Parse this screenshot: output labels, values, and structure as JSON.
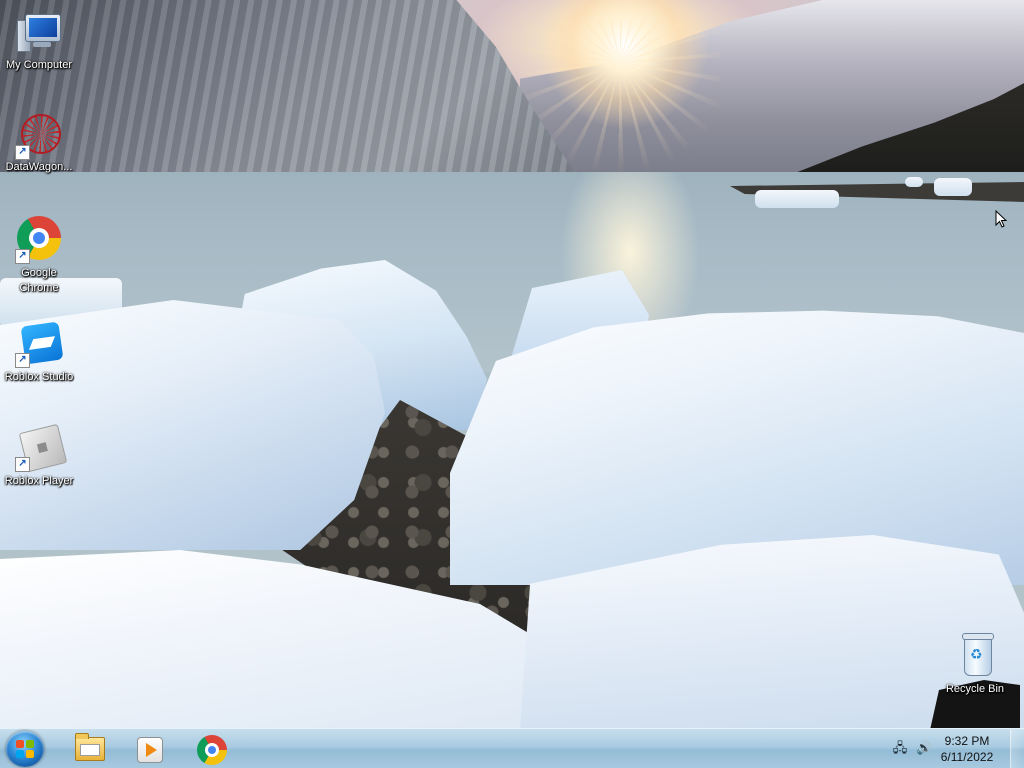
{
  "desktop": {
    "icons": [
      {
        "label": "My Computer",
        "icon": "computer-icon"
      },
      {
        "label": "DataWagon...",
        "icon": "datawagon-icon",
        "shortcut": true
      },
      {
        "label": "Google Chrome",
        "icon": "chrome-icon",
        "shortcut": true
      },
      {
        "label": "Roblox Studio",
        "icon": "roblox-studio-icon",
        "shortcut": true
      },
      {
        "label": "Roblox Player",
        "icon": "roblox-player-icon",
        "shortcut": true
      },
      {
        "label": "Recycle Bin",
        "icon": "recycle-bin-icon"
      }
    ]
  },
  "taskbar": {
    "start": {
      "icon": "windows-logo-icon"
    },
    "pinned": [
      {
        "name": "Windows Explorer",
        "icon": "folder-icon"
      },
      {
        "name": "Windows Media Player",
        "icon": "media-player-icon"
      },
      {
        "name": "Google Chrome",
        "icon": "chrome-icon"
      }
    ],
    "tray": {
      "icons": [
        "network-icon",
        "volume-icon"
      ],
      "time": "9:32 PM",
      "date": "6/11/2022"
    }
  },
  "colors": {
    "taskbar": "#a9cbe1",
    "label_text": "#ffffff"
  }
}
